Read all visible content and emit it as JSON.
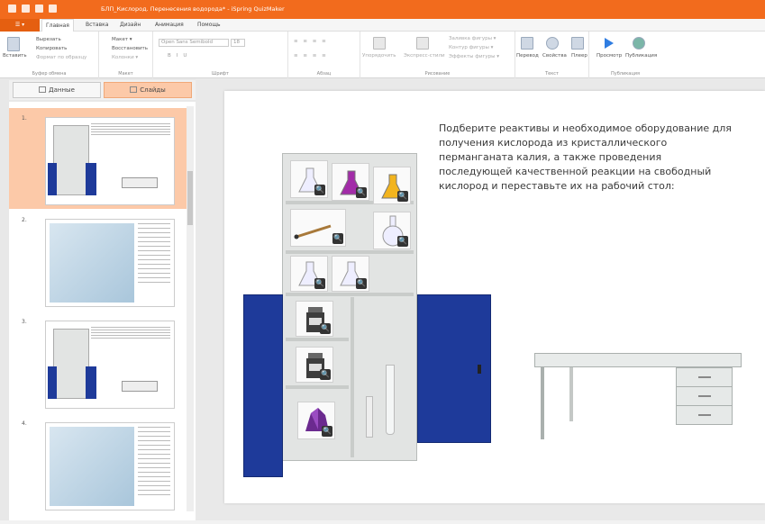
{
  "window": {
    "title": "БЛП_Кислород. Перенесения водорода* - iSpring QuizMaker"
  },
  "tabs": {
    "file": "☰ ▾",
    "home": "Главная",
    "insert": "Вставка",
    "design": "Дизайн",
    "animation": "Анимация",
    "help": "Помощь"
  },
  "ribbon": {
    "clipboard": {
      "label": "Буфер обмена",
      "paste": "Вставить",
      "cut": "Вырезать",
      "copy": "Копировать",
      "format_painter": "Формат по образцу"
    },
    "layout": {
      "label": "Макет",
      "layout": "Макет ▾",
      "restore": "Восстановить",
      "columns": "Колонки ▾"
    },
    "font": {
      "label": "Шрифт",
      "family": "Open Sans Semibold",
      "size": "18"
    },
    "paragraph": {
      "label": "Абзац"
    },
    "drawing": {
      "label": "Рисование",
      "arrange": "Упорядочить",
      "quick_styles": "Экспресс-стили",
      "fill": "Заливка фигуры ▾",
      "outline": "Контур фигуры ▾",
      "effects": "Эффекты фигуры ▾"
    },
    "text": {
      "label": "Текст",
      "translate": "Перевод",
      "properties": "Свойства",
      "player": "Плеер"
    },
    "publish": {
      "label": "Публикация",
      "preview": "Просмотр",
      "publish": "Публикация"
    }
  },
  "sidebar": {
    "data_tab": "Данные",
    "slides_tab": "Слайды",
    "slides": [
      {
        "num": "1."
      },
      {
        "num": "2."
      },
      {
        "num": "3."
      },
      {
        "num": "4."
      }
    ]
  },
  "slide": {
    "text": "Подберите реактивы и необходимое оборудование для получения кислорода из кристаллического перманганата калия, а также проведения последующей качественной реакции на свободный кислород и переставьте их на рабочий стол:"
  },
  "colors": {
    "accent": "#f26b1d",
    "selected": "#fcc9a8",
    "door": "#1e3a9a"
  }
}
